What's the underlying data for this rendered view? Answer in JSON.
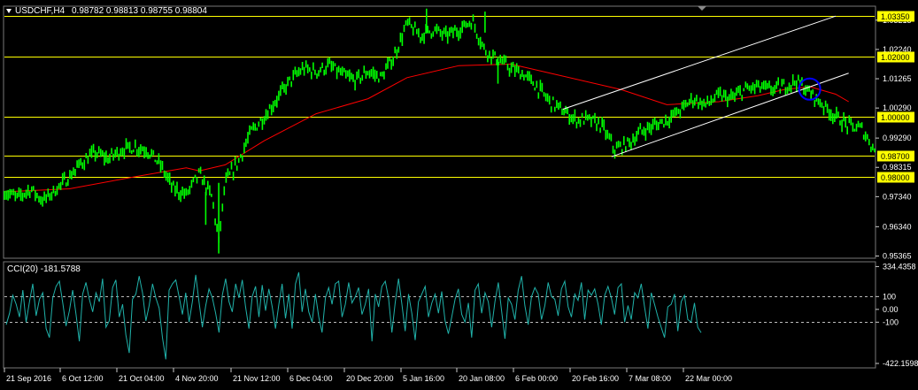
{
  "window": {
    "symbol_label": "USDCHF,H4",
    "ohlc_label": "0.98782 0.98813 0.98755 0.98804",
    "collapse_icon": "triangle-down-icon",
    "scroll_marker_icon": "triangle-down-icon"
  },
  "colors": {
    "background": "#000000",
    "price": "#00FF00",
    "moving_average": "#FF0000",
    "horizontal_level": "#FFFF00",
    "channel": "#FFFFFF",
    "marker_circle": "#0000FF",
    "cci": "#20B2AA",
    "text": "#FFFFFF"
  },
  "chart_data": [
    {
      "type": "line",
      "name": "price",
      "title": "USDCHF,H4",
      "ylim": [
        0.9532,
        1.0365
      ],
      "x_dates": [
        "21 Sep 2016",
        "6 Oct 12:00",
        "21 Oct 04:00",
        "4 Nov 20:00",
        "21 Nov 12:00",
        "6 Dec 04:00",
        "20 Dec 20:00",
        "5 Jan 16:00",
        "20 Jan 08:00",
        "6 Feb 00:00",
        "20 Feb 16:00",
        "7 Mar 08:00",
        "22 Mar 00:00"
      ],
      "y_ticks": [
        1.03215,
        1.0224,
        1.01265,
        1.0029,
        0.9929,
        0.98315,
        0.9734,
        0.9634,
        0.95365
      ],
      "levels": [
        {
          "label": "1.03350",
          "value": 1.0335
        },
        {
          "label": "1.02000",
          "value": 1.02
        },
        {
          "label": "1.00000",
          "value": 1.0
        },
        {
          "label": "0.98700",
          "value": 0.987
        },
        {
          "label": "0.98000",
          "value": 0.98
        }
      ],
      "series": [
        {
          "label": "USDCHF close (approx.)",
          "points": [
            [
              0,
              0.975
            ],
            [
              4,
              0.973
            ],
            [
              8,
              0.976
            ],
            [
              12,
              0.972
            ],
            [
              16,
              0.976
            ],
            [
              20,
              0.98
            ],
            [
              24,
              0.985
            ],
            [
              28,
              0.988
            ],
            [
              32,
              0.986
            ],
            [
              36,
              0.989
            ],
            [
              40,
              0.99
            ],
            [
              44,
              0.989
            ],
            [
              48,
              0.984
            ],
            [
              52,
              0.976
            ],
            [
              56,
              0.974
            ],
            [
              60,
              0.981
            ],
            [
              64,
              0.973
            ],
            [
              66,
              0.958
            ],
            [
              68,
              0.978
            ],
            [
              72,
              0.985
            ],
            [
              76,
              0.995
            ],
            [
              80,
              1.0
            ],
            [
              84,
              1.006
            ],
            [
              88,
              1.012
            ],
            [
              92,
              1.016
            ],
            [
              96,
              1.015
            ],
            [
              100,
              1.017
            ],
            [
              104,
              1.014
            ],
            [
              108,
              1.012
            ],
            [
              112,
              1.015
            ],
            [
              116,
              1.013
            ],
            [
              120,
              1.02
            ],
            [
              124,
              1.031
            ],
            [
              128,
              1.027
            ],
            [
              132,
              1.029
            ],
            [
              136,
              1.027
            ],
            [
              140,
              1.029
            ],
            [
              144,
              1.032
            ],
            [
              148,
              1.022
            ],
            [
              152,
              1.019
            ],
            [
              156,
              1.016
            ],
            [
              160,
              1.014
            ],
            [
              164,
              1.01
            ],
            [
              168,
              1.005
            ],
            [
              172,
              1.002
            ],
            [
              176,
              0.999
            ],
            [
              180,
              0.999
            ],
            [
              184,
              0.997
            ],
            [
              188,
              0.989
            ],
            [
              192,
              0.991
            ],
            [
              196,
              0.995
            ],
            [
              200,
              0.997
            ],
            [
              204,
              0.999
            ],
            [
              208,
              1.002
            ],
            [
              212,
              1.006
            ],
            [
              216,
              1.004
            ],
            [
              220,
              1.007
            ],
            [
              224,
              1.006
            ],
            [
              228,
              1.009
            ],
            [
              232,
              1.01
            ],
            [
              236,
              1.009
            ],
            [
              240,
              1.01
            ],
            [
              244,
              1.012
            ],
            [
              248,
              1.008
            ],
            [
              252,
              1.004
            ],
            [
              256,
              1.0
            ],
            [
              260,
              0.997
            ],
            [
              264,
              0.996
            ],
            [
              268,
              0.989
            ]
          ]
        },
        {
          "label": "Moving average (approx.)",
          "points": [
            [
              0,
              0.975
            ],
            [
              20,
              0.976
            ],
            [
              40,
              0.98
            ],
            [
              56,
              0.983
            ],
            [
              60,
              0.982
            ],
            [
              68,
              0.984
            ],
            [
              80,
              0.992
            ],
            [
              96,
              1.001
            ],
            [
              112,
              1.006
            ],
            [
              124,
              1.013
            ],
            [
              140,
              1.017
            ],
            [
              156,
              1.0175
            ],
            [
              170,
              1.014
            ],
            [
              190,
              1.009
            ],
            [
              204,
              1.004
            ],
            [
              220,
              1.005
            ],
            [
              232,
              1.007
            ],
            [
              240,
              1.009
            ],
            [
              248,
              1.01
            ],
            [
              256,
              1.0075
            ],
            [
              260,
              1.005
            ]
          ]
        }
      ],
      "channel": {
        "upper": [
          [
            172,
            1.0025
          ],
          [
            256,
            1.0335
          ]
        ],
        "lower": [
          [
            187,
            0.9867
          ],
          [
            260,
            1.0145
          ]
        ]
      },
      "marker": {
        "x": 248,
        "y": 1.0092
      }
    },
    {
      "type": "line",
      "name": "cci",
      "title": "CCI(20) -181.5788",
      "ylim": [
        -450,
        365
      ],
      "y_ticks": [
        {
          "label": "334.4358",
          "value": 334.4358
        },
        {
          "label": "100",
          "value": 100
        },
        {
          "label": "0.00",
          "value": 0
        },
        {
          "label": "-100",
          "value": -100
        },
        {
          "label": "-422.1598",
          "value": -422.1598
        }
      ],
      "levels": [
        100,
        -100
      ],
      "series": [
        {
          "label": "CCI(20) (approx.)",
          "values": [
            -120,
            -30,
            110,
            40,
            -60,
            150,
            -100,
            60,
            200,
            -50,
            80,
            130,
            -150,
            -220,
            90,
            180,
            220,
            50,
            -130,
            -10,
            150,
            -40,
            -250,
            120,
            210,
            80,
            -20,
            130,
            60,
            240,
            -140,
            -90,
            170,
            230,
            -60,
            40,
            -200,
            -340,
            80,
            120,
            260,
            130,
            -90,
            30,
            200,
            90,
            10,
            -220,
            -390,
            150,
            200,
            230,
            100,
            -40,
            130,
            -100,
            60,
            270,
            60,
            -140,
            30,
            160,
            90,
            -30,
            -180,
            110,
            240,
            60,
            -20,
            200,
            90,
            230,
            20,
            -150,
            100,
            180,
            -60,
            190,
            -10,
            160,
            20,
            -150,
            40,
            200,
            -70,
            120,
            -150,
            200,
            290,
            -20,
            160,
            -20,
            -100,
            120,
            -60,
            -180,
            90,
            170,
            40,
            200,
            220,
            -60,
            40,
            210,
            50,
            100,
            170,
            -40,
            40,
            160,
            -250,
            120,
            20,
            180,
            220,
            90,
            -180,
            50,
            240,
            40,
            -170,
            120,
            -30,
            -240,
            60,
            120,
            180,
            -60,
            50,
            120,
            -30,
            140,
            -90,
            -190,
            -60,
            80,
            160,
            -40,
            -100,
            50,
            -220,
            150,
            200,
            -30,
            130,
            60,
            -140,
            60,
            210,
            -10,
            -230,
            90,
            40,
            -80,
            150,
            260,
            30,
            -120,
            100,
            170,
            120,
            -80,
            30,
            210,
            100,
            80,
            -50,
            160,
            220,
            20,
            -60,
            120,
            70,
            210,
            -80,
            150,
            110,
            160,
            40,
            -120,
            110,
            180,
            90,
            -40,
            170,
            200,
            -100,
            30,
            -80,
            130,
            90,
            200,
            20,
            -150,
            130,
            40,
            -60,
            -140,
            -220,
            20,
            40,
            120,
            -170,
            60,
            110,
            -80,
            -100,
            50,
            -140,
            -181.58
          ]
        }
      ]
    }
  ],
  "x_tick_labels": [
    "21 Sep 2016",
    "6 Oct 12:00",
    "21 Oct 04:00",
    "4 Nov 20:00",
    "21 Nov 12:00",
    "6 Dec 04:00",
    "20 Dec 20:00",
    "5 Jan 16:00",
    "20 Jan 08:00",
    "6 Feb 00:00",
    "20 Feb 16:00",
    "7 Mar 08:00",
    "22 Mar 00:00"
  ]
}
